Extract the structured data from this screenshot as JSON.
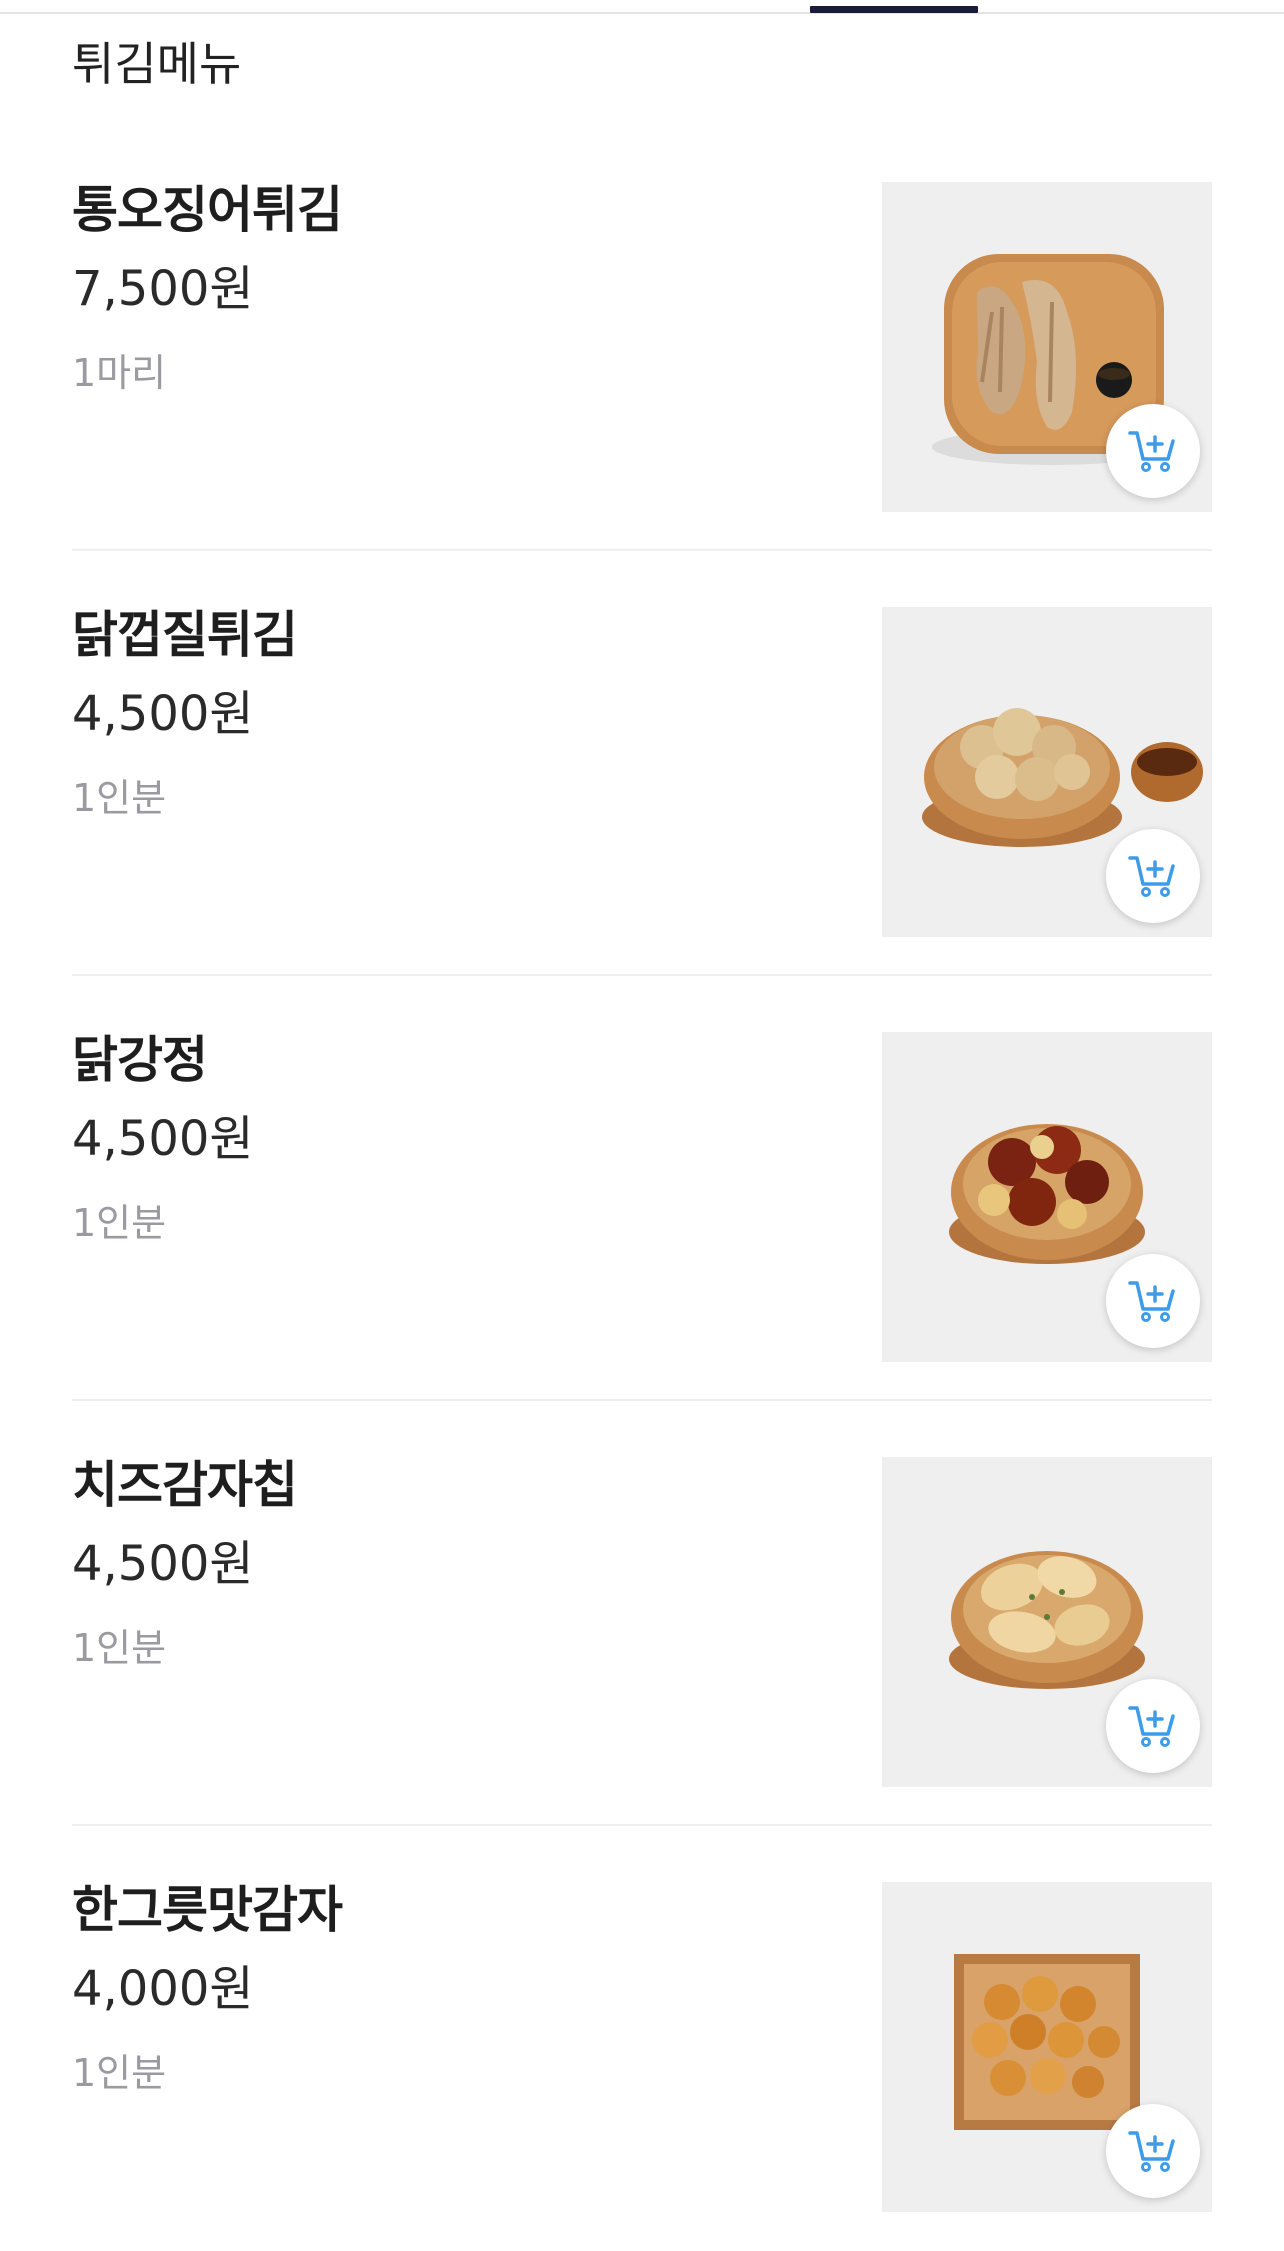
{
  "section": {
    "title": "튀김메뉴"
  },
  "menu_items": [
    {
      "name": "통오징어튀김",
      "price": "7,500원",
      "unit": "1마리",
      "image": "fried-squid-on-board"
    },
    {
      "name": "닭껍질튀김",
      "price": "4,500원",
      "unit": "1인분",
      "image": "fried-chicken-skin-bowl"
    },
    {
      "name": "닭강정",
      "price": "4,500원",
      "unit": "1인분",
      "image": "glazed-chicken-bowl"
    },
    {
      "name": "치즈감자칩",
      "price": "4,500원",
      "unit": "1인분",
      "image": "cheese-potato-chips-bowl"
    },
    {
      "name": "한그릇맛감자",
      "price": "4,000원",
      "unit": "1인분",
      "image": "potato-bites-box"
    }
  ],
  "icons": {
    "cart": "add-to-cart-icon"
  },
  "colors": {
    "tab_indicator": "#1a1a3a",
    "cart_icon": "#3d9be9",
    "muted_text": "#9a9aa0"
  }
}
